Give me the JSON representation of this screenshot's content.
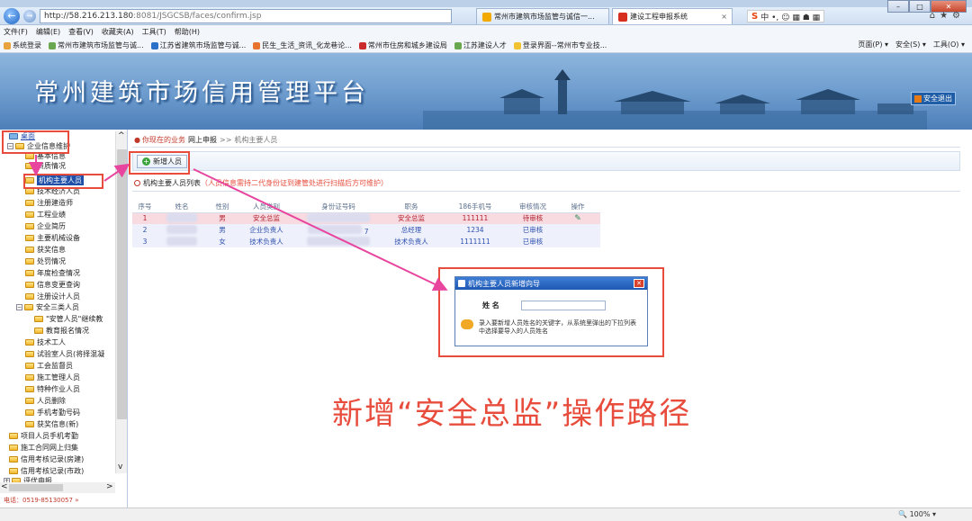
{
  "browser": {
    "url_host": "http://58.216.213.180",
    "url_path": ":8081/JSGCSB/faces/confirm.jsp",
    "tabs": [
      {
        "label": "常州市建筑市场监管与诚信一..."
      },
      {
        "label": "建设工程申报系统"
      }
    ],
    "menu": [
      "文件(F)",
      "编辑(E)",
      "查看(V)",
      "收藏夹(A)",
      "工具(T)",
      "帮助(H)"
    ],
    "favorites": [
      "系统登录",
      "常州市建筑市场监管与诚...",
      "江苏省建筑市场监管与诚...",
      "民生_生活_资讯_化龙巷论...",
      "常州市住房和城乡建设局",
      "江苏建设人才",
      "登录界面--常州市专业技..."
    ],
    "commands": [
      "页面(P) ▾",
      "安全(S) ▾",
      "工具(O) ▾"
    ],
    "zoom": "100%"
  },
  "banner": {
    "title": "常州建筑市场信用管理平台",
    "logout": "安全退出"
  },
  "sidebar": {
    "items": [
      {
        "label": "桌面"
      },
      {
        "label": "企业信息维护"
      },
      {
        "label": "基本信息"
      },
      {
        "label": "资质情况"
      },
      {
        "label": "机构主要人员"
      },
      {
        "label": "技术经济人员"
      },
      {
        "label": "注册建造师"
      },
      {
        "label": "工程业绩"
      },
      {
        "label": "企业简历"
      },
      {
        "label": "主要机械设备"
      },
      {
        "label": "获奖信息"
      },
      {
        "label": "处罚情况"
      },
      {
        "label": "年度检查情况"
      },
      {
        "label": "信息变更查询"
      },
      {
        "label": "注册设计人员"
      },
      {
        "label": "安全三类人员"
      },
      {
        "label": "\"安管人员\"继续教"
      },
      {
        "label": "教育报名情况"
      },
      {
        "label": "技术工人"
      },
      {
        "label": "试验室人员(将择混凝"
      },
      {
        "label": "工会监督员"
      },
      {
        "label": "施工管理人员"
      },
      {
        "label": "特种作业人员"
      },
      {
        "label": "人员删除"
      },
      {
        "label": "手机考勤号码"
      },
      {
        "label": "获奖信息(新)"
      },
      {
        "label": "项目人员手机考勤"
      },
      {
        "label": "施工合同网上归集"
      },
      {
        "label": "信用考核记录(房建)"
      },
      {
        "label": "信用考核记录(市政)"
      },
      {
        "label": "评优申报"
      }
    ],
    "status_phone": "电话：0519-85130057 »"
  },
  "main": {
    "breadcrumb": {
      "current": "你现在的业务",
      "section": "网上申报",
      "sep": ">>",
      "page": "机构主要人员"
    },
    "add_button": "新增人员",
    "list_title": "机构主要人员列表",
    "list_note": "（人员信息需持二代身份证到建管处进行扫描后方可维护）",
    "columns": [
      "序号",
      "姓名",
      "性别",
      "人员类别",
      "身份证号码",
      "职务",
      "186手机号",
      "审核情况",
      "操作"
    ],
    "rows": [
      {
        "no": "1",
        "gender": "男",
        "category": "安全总监",
        "id_tail": "",
        "title": "安全总监",
        "phone": "111111",
        "status": "待审核"
      },
      {
        "no": "2",
        "gender": "男",
        "category": "企业负责人",
        "id_tail": "7",
        "title": "总经理",
        "phone": "1234",
        "status": "已审核"
      },
      {
        "no": "3",
        "gender": "女",
        "category": "技术负责人",
        "id_tail": "",
        "title": "技术负责人",
        "phone": "1111111",
        "status": "已审核"
      }
    ]
  },
  "dialog": {
    "title": "机构主要人员新增向导",
    "field_label": "姓  名",
    "hint": "录入要新增人员姓名的关键字，从系统里弹出的下拉列表中选择要导入的人员姓名"
  },
  "annotation": {
    "caption": "新增“安全总监”操作路径"
  }
}
